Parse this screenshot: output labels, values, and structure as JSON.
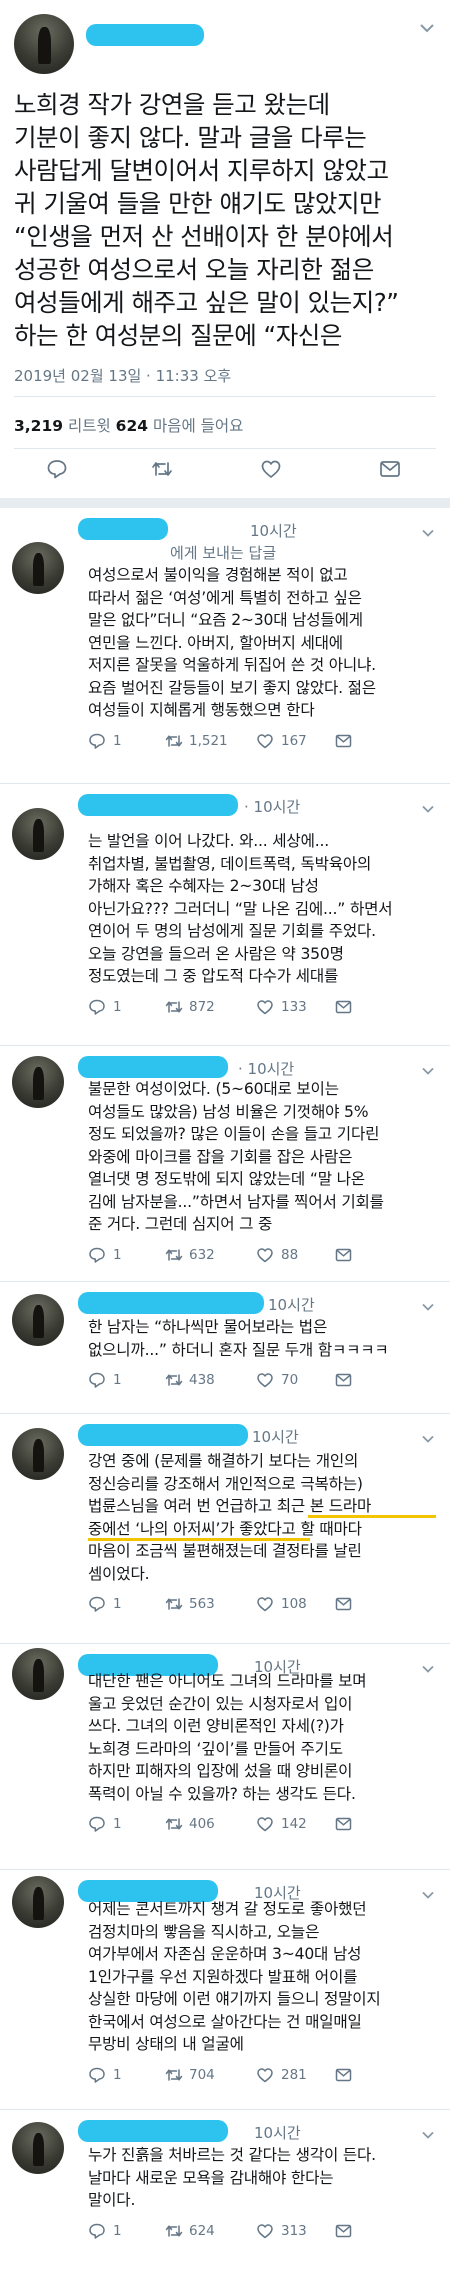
{
  "main": {
    "text": "노희경 작가 강연을 듣고 왔는데\n기분이 좋지 않다. 말과 글을 다루는\n사람답게 달변이어서 지루하지 않았고\n귀 기울여 들을 만한 얘기도 많았지만\n“인생을 먼저 산 선배이자 한 분야에서\n성공한 여성으로서 오늘 자리한 젊은\n여성들에게 해주고 싶은 말이 있는지?”\n하는 한 여성분의 질문에 “자신은",
    "timestamp": "2019년 02월 13일 · 11:33 오후",
    "retweet_count": "3,219",
    "retweet_label": " 리트윗 ",
    "like_count": "624",
    "like_label": " 마음에 들어요"
  },
  "replies": [
    {
      "time": "10시간",
      "partial_header": "에게 보내는 답글",
      "text": "여성으로서 불이익을 경험해본 적이 없고\n따라서 젊은 ‘여성’에게 특별히 전하고 싶은\n말은 없다”더니 “요즘 2~30대 남성들에게\n연민을 느낀다. 아버지, 할아버지 세대에\n저지른 잘못을 억울하게 뒤집어 쓴 것 아니냐.\n요즘 벌어진 갈등들이 보기 좋지 않았다. 젊은\n여성들이 지혜롭게 행동했으면 한다",
      "comments": "1",
      "retweets": "1,521",
      "likes": "167"
    },
    {
      "time": "· 10시간",
      "text": "는 발언을 이어 나갔다. 와... 세상에...\n취업차별, 불법촬영, 데이트폭력, 독박육아의\n가해자 혹은 수혜자는 2~30대 남성\n아닌가요??? 그러더니 “말 나온 김에...” 하면서\n연이어 두 명의 남성에게 질문 기회를 주었다.\n오늘 강연을 들으러 온 사람은 약 350명\n정도였는데 그 중 압도적 다수가 세대를",
      "comments": "1",
      "retweets": "872",
      "likes": "133"
    },
    {
      "time": "· 10시간",
      "text": "불문한 여성이었다. (5~60대로 보이는\n여성들도 많았음) 남성 비율은 기껏해야 5%\n정도 되었을까? 많은 이들이 손을 들고 기다린\n와중에 마이크를 잡을 기회를 잡은 사람은\n열너댓 명 정도밖에 되지 않았는데 “말 나온\n김에 남자분을...”하면서 남자를 찍어서 기회를\n준 거다. 그런데 심지어 그 중",
      "comments": "1",
      "retweets": "632",
      "likes": "88"
    },
    {
      "time": "10시간",
      "text": "한 남자는 “하나씩만 물어보라는 법은\n없으니까...” 하더니 혼자 질문 두개 함ㅋㅋㅋㅋ",
      "comments": "1",
      "retweets": "438",
      "likes": "70"
    },
    {
      "time": "10시간",
      "text": "강연 중에 (문제를 해결하기 보다는 개인의\n정신승리를 강조해서 개인적으로 극복하는)\n법륜스님을 여러 번 언급하고 최근 본 드라마\n중에선 ‘나의 아저씨’가 좋았다고 할 때마다\n마음이 조금씩 불편해졌는데 결정타를 날린\n셈이었다.",
      "comments": "1",
      "retweets": "563",
      "likes": "108"
    },
    {
      "time": "10시간",
      "text": "대단한 팬은 아니어도 그녀의 드라마를 보며\n울고 웃었던 순간이 있는 시청자로서 입이\n쓰다. 그녀의 이런 양비론적인 자세(?)가\n노희경 드라마의 ‘깊이’를 만들어 주기도\n하지만 피해자의 입장에 섰을 때 양비론이\n폭력이 아닐 수 있을까? 하는 생각도 든다.",
      "comments": "1",
      "retweets": "406",
      "likes": "142"
    },
    {
      "time": "10시간",
      "text": "어제는 콘서트까지 챙겨 갈 정도로 좋아했던\n검정치마의 빻음을 직시하고, 오늘은\n여가부에서 자존심 운운하며 3~40대 남성\n1인가구를 우선 지원하겠다 발표해 어이를\n상실한 마당에 이런 얘기까지 들으니 정말이지\n한국에서 여성으로 살아간다는 건 매일매일\n무방비 상태의 내 얼굴에",
      "comments": "1",
      "retweets": "704",
      "likes": "281"
    },
    {
      "time": "10시간",
      "text": "누가 진흙을 처바르는 것 같다는 생각이 든다.\n날마다 새로운 모욕을 감내해야 한다는\n말이다.",
      "comments": "1",
      "retweets": "624",
      "likes": "313"
    }
  ],
  "colors": {
    "text": "#14171a",
    "muted": "#657786",
    "redaction": "#2ec3ef",
    "highlight": "#f5c400",
    "separator": "#e6ecf0"
  },
  "icons": [
    "reply-icon",
    "retweet-icon",
    "like-icon",
    "dm-icon",
    "chevron-down-icon"
  ]
}
